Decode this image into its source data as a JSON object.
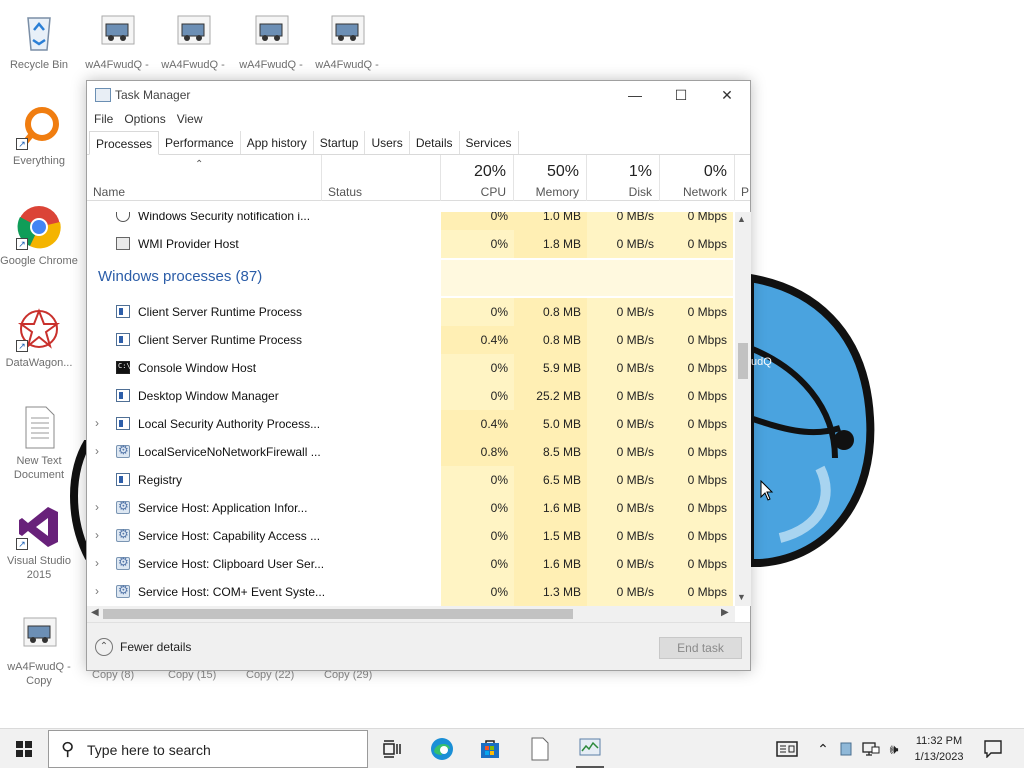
{
  "desktop": {
    "icons": [
      {
        "label": "Recycle Bin"
      },
      {
        "label": "wA4FwudQ -"
      },
      {
        "label": "wA4FwudQ -"
      },
      {
        "label": "wA4FwudQ -"
      },
      {
        "label": "wA4FwudQ -"
      },
      {
        "label": "Everything"
      },
      {
        "label": "Google Chrome"
      },
      {
        "label": "DataWagon..."
      },
      {
        "label": "New Text Document"
      },
      {
        "label": "Visual Studio 2015"
      },
      {
        "label": "wA4FwudQ - Copy"
      }
    ],
    "hidden_labels": [
      "Copy (8)",
      "Copy (15)",
      "Copy (22)",
      "Copy (29)"
    ],
    "right_label": "udQ"
  },
  "task_manager": {
    "title": "Task Manager",
    "menu": [
      "File",
      "Options",
      "View"
    ],
    "tabs": [
      "Processes",
      "Performance",
      "App history",
      "Startup",
      "Users",
      "Details",
      "Services"
    ],
    "active_tab": "Processes",
    "columns": {
      "name": "Name",
      "status": "Status",
      "cpu": {
        "pct": "20%",
        "label": "CPU"
      },
      "memory": {
        "pct": "50%",
        "label": "Memory"
      },
      "disk": {
        "pct": "1%",
        "label": "Disk"
      },
      "network": {
        "pct": "0%",
        "label": "Network"
      },
      "power": "P"
    },
    "rows_top": [
      {
        "name": "Windows Security notification i...",
        "cpu": "0%",
        "mem": "1.0 MB",
        "disk": "0 MB/s",
        "net": "0 Mbps",
        "icon": "shield-icon"
      },
      {
        "name": "WMI Provider Host",
        "cpu": "0%",
        "mem": "1.8 MB",
        "disk": "0 MB/s",
        "net": "0 Mbps",
        "icon": "wmi-icon"
      }
    ],
    "group_title": "Windows processes (87)",
    "rows": [
      {
        "name": "Client Server Runtime Process",
        "cpu": "0%",
        "mem": "0.8 MB",
        "disk": "0 MB/s",
        "net": "0 Mbps",
        "expand": false,
        "icon": "app-icon"
      },
      {
        "name": "Client Server Runtime Process",
        "cpu": "0.4%",
        "mem": "0.8 MB",
        "disk": "0 MB/s",
        "net": "0 Mbps",
        "expand": false,
        "icon": "app-icon"
      },
      {
        "name": "Console Window Host",
        "cpu": "0%",
        "mem": "5.9 MB",
        "disk": "0 MB/s",
        "net": "0 Mbps",
        "expand": false,
        "icon": "console-icon"
      },
      {
        "name": "Desktop Window Manager",
        "cpu": "0%",
        "mem": "25.2 MB",
        "disk": "0 MB/s",
        "net": "0 Mbps",
        "expand": false,
        "icon": "app-icon"
      },
      {
        "name": "Local Security Authority Process...",
        "cpu": "0.4%",
        "mem": "5.0 MB",
        "disk": "0 MB/s",
        "net": "0 Mbps",
        "expand": true,
        "icon": "app-icon"
      },
      {
        "name": "LocalServiceNoNetworkFirewall ...",
        "cpu": "0.8%",
        "mem": "8.5 MB",
        "disk": "0 MB/s",
        "net": "0 Mbps",
        "expand": true,
        "icon": "gear-icon"
      },
      {
        "name": "Registry",
        "cpu": "0%",
        "mem": "6.5 MB",
        "disk": "0 MB/s",
        "net": "0 Mbps",
        "expand": false,
        "icon": "app-icon"
      },
      {
        "name": "Service Host: Application Infor...",
        "cpu": "0%",
        "mem": "1.6 MB",
        "disk": "0 MB/s",
        "net": "0 Mbps",
        "expand": true,
        "icon": "gear-icon"
      },
      {
        "name": "Service Host: Capability Access ...",
        "cpu": "0%",
        "mem": "1.5 MB",
        "disk": "0 MB/s",
        "net": "0 Mbps",
        "expand": true,
        "icon": "gear-icon"
      },
      {
        "name": "Service Host: Clipboard User Ser...",
        "cpu": "0%",
        "mem": "1.6 MB",
        "disk": "0 MB/s",
        "net": "0 Mbps",
        "expand": true,
        "icon": "gear-icon"
      },
      {
        "name": "Service Host: COM+ Event Syste...",
        "cpu": "0%",
        "mem": "1.3 MB",
        "disk": "0 MB/s",
        "net": "0 Mbps",
        "expand": true,
        "icon": "gear-icon"
      }
    ],
    "fewer_details": "Fewer details",
    "end_task": "End task"
  },
  "taskbar": {
    "search_placeholder": "Type here to search",
    "time": "11:32 PM",
    "date": "1/13/2023"
  },
  "colors": {
    "accent_blue": "#2b5da8",
    "cpu_heat_light": "#fff9df",
    "cpu_heat_mid": "#fff4c4",
    "cpu_heat_strong": "#ffefb4"
  }
}
